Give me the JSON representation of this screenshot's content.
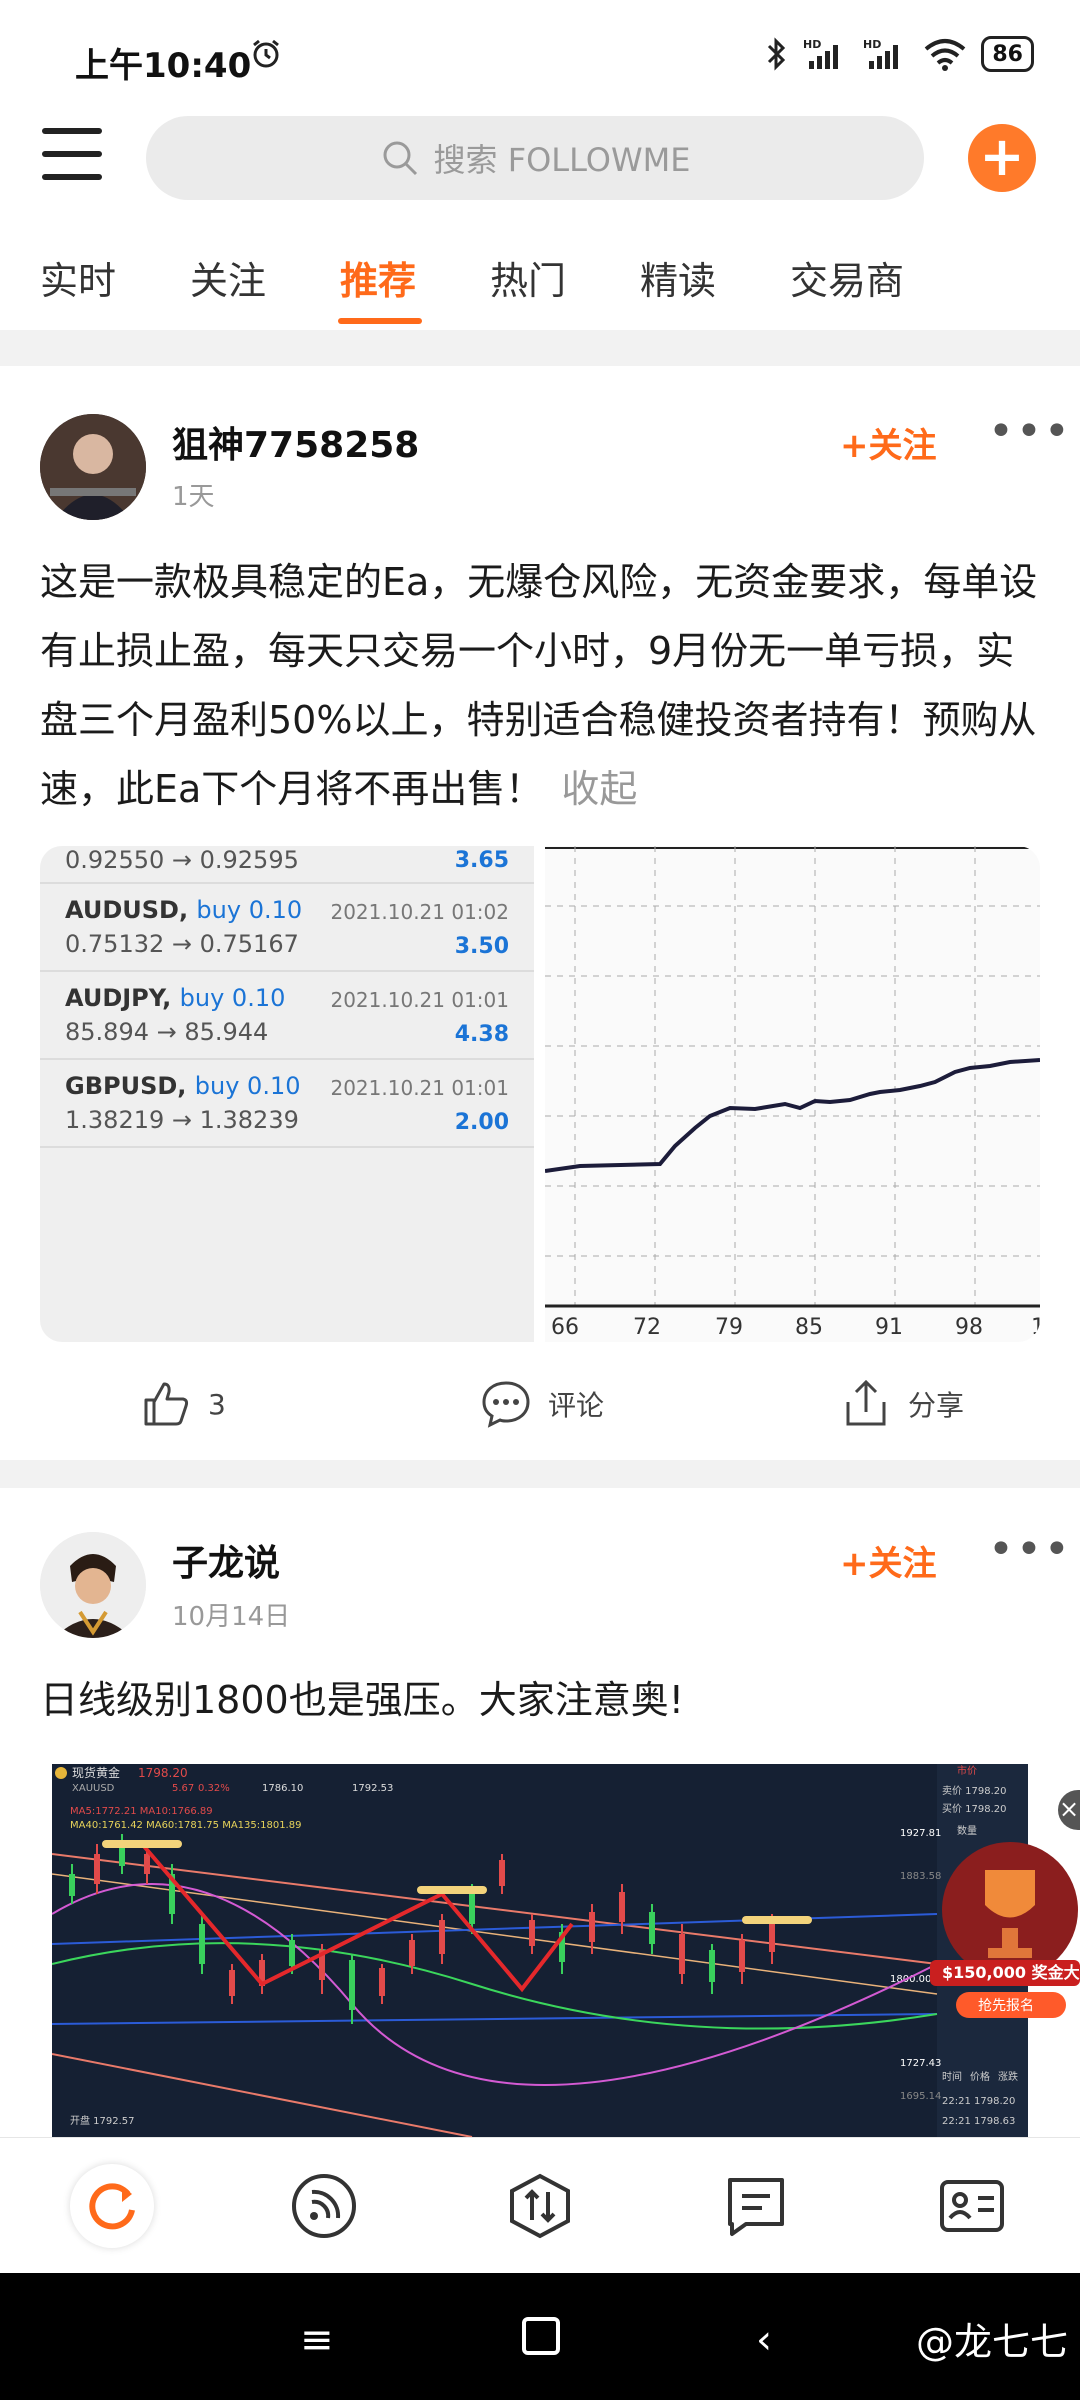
{
  "status_bar": {
    "time": "上午10:40",
    "battery": "86",
    "network_labels": [
      "HD",
      "HD"
    ]
  },
  "header": {
    "search_placeholder": "搜索 FOLLOWME"
  },
  "tabs": [
    {
      "label": "实时",
      "active": false
    },
    {
      "label": "关注",
      "active": false
    },
    {
      "label": "推荐",
      "active": true
    },
    {
      "label": "热门",
      "active": false
    },
    {
      "label": "精读",
      "active": false
    },
    {
      "label": "交易商",
      "active": false
    }
  ],
  "posts": [
    {
      "author": "狙神7758258",
      "time": "1天",
      "follow_label": "+关注",
      "text": "这是一款极具稳定的Ea，无爆仓风险，无资金要求，每单设有止损止盈，每天只交易一个小时，9月份无一单亏损，实盘三个月盈利50%以上，特别适合稳健投资者持有！预购从速，此Ea下个月将不再出售！",
      "collapse_label": "收起",
      "trades": [
        {
          "price": "0.92550 → 0.92595",
          "profit": "3.65"
        },
        {
          "pair": "AUDUSD,",
          "side": "buy 0.10",
          "date": "2021.10.21 01:02",
          "price": "0.75132 → 0.75167",
          "profit": "3.50"
        },
        {
          "pair": "AUDJPY,",
          "side": "buy 0.10",
          "date": "2021.10.21 01:01",
          "price": "85.894 → 85.944",
          "profit": "4.38"
        },
        {
          "pair": "GBPUSD,",
          "side": "buy 0.10",
          "date": "2021.10.21 01:01",
          "price": "1.38219 → 1.38239",
          "profit": "2.00"
        }
      ],
      "equity_x_labels": [
        "66",
        "72",
        "79",
        "85",
        "91",
        "98",
        "1"
      ],
      "likes": "3",
      "comment_label": "评论",
      "share_label": "分享"
    },
    {
      "author": "子龙说",
      "time": "10月14日",
      "follow_label": "+关注",
      "text": "日线级别1800也是强压。大家注意奥!",
      "chart_header": {
        "name": "现货黄金",
        "symbol": "XAUUSD",
        "price": "1798.20",
        "change": "5.67",
        "change_pct": "0.32%",
        "high": "1786.10",
        "prev_close": "1792.53"
      },
      "chart_ma_line1": "MA5:1772.21  MA10:1766.89",
      "chart_ma_line2": "MA40:1761.42  MA60:1781.75  MA135:1801.89",
      "chart_right_panel": [
        "市价",
        "卖价 1798.20",
        "买价 1798.20",
        "数量"
      ],
      "chart_price_labels": [
        "1927.81",
        "1883.58",
        "1800.00",
        "1727.43",
        "1695.14"
      ],
      "chart_bottom_left": [
        "开盘 1792.57"
      ],
      "chart_times": [
        "22:21 1798.20",
        "22:21 1798.63"
      ],
      "chart_table_header": [
        "时间",
        "价格",
        "涨跌"
      ],
      "promo_amount": "$150,000 奖金大",
      "promo_button": "抢先报名"
    }
  ],
  "watermark": "@龙七七"
}
